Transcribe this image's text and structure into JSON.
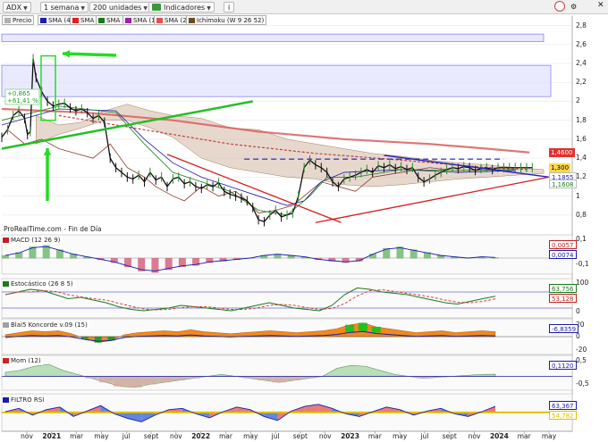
{
  "toolbar": {
    "symbol": "ADX",
    "timeframe": "1 semana",
    "units": "200 unidades",
    "indicators": "Indicadores"
  },
  "legend": [
    {
      "label": "Precio",
      "color": "#b0b0b0"
    },
    {
      "label": "SMA (40)",
      "color": "#1c1caa"
    },
    {
      "label": "SMA (4)",
      "color": "#e02020"
    },
    {
      "label": "SMA (20)",
      "color": "#1a7a1a"
    },
    {
      "label": "SMA (120)",
      "color": "#a020a0"
    },
    {
      "label": "SMA (200)",
      "color": "#e05050"
    },
    {
      "label": "Ichimoku (W 9 26 52)",
      "color": "#6b4b20"
    }
  ],
  "source_note": "ProRealTime.com - Fin de Día",
  "colors": {
    "candle_up": "#2a8a2a",
    "candle_down": "#111111",
    "cloud": "#c9a890",
    "sma200": "#d86060",
    "trendline_green": "#22c022",
    "arrow": "#22dd22",
    "triangle_top": "#2020c0",
    "triangle_bottom": "#d02020",
    "box": "#8888ee"
  },
  "chart_data": [
    {
      "type": "line",
      "name": "price",
      "y_ticks": [
        2.8,
        2.6,
        2.4,
        2.2,
        2,
        1.8,
        1.6,
        1.4,
        1.2,
        1,
        0.8
      ],
      "ylim": [
        0.6,
        2.9
      ],
      "x_ticks": [
        "nov",
        "2021",
        "mar",
        "may",
        "jul",
        "sept",
        "nov",
        "2022",
        "mar",
        "may",
        "jul",
        "sept",
        "nov",
        "2023",
        "mar",
        "may",
        "jul",
        "sept",
        "nov",
        "2024",
        "mar",
        "may"
      ],
      "x_bold": [
        "2021",
        "2022",
        "2023",
        "2024"
      ],
      "series": [
        {
          "x": [
            0,
            2,
            4,
            6,
            8,
            9,
            10,
            11,
            12,
            14,
            16,
            18,
            20,
            22,
            24,
            26,
            28,
            30,
            32,
            34,
            36,
            38,
            40,
            42,
            44,
            46,
            48,
            50,
            52,
            54,
            56,
            58,
            60,
            62,
            64,
            66,
            68,
            70,
            72,
            74,
            76,
            78,
            80,
            82,
            84,
            86,
            88,
            90,
            92,
            94,
            96,
            98,
            100,
            102,
            104,
            106,
            108,
            110,
            112,
            114,
            116,
            118,
            120,
            122,
            124,
            126,
            128,
            130,
            132,
            134,
            136,
            138,
            140,
            142,
            144,
            146,
            148,
            150,
            152,
            154,
            156,
            158,
            160,
            162,
            164,
            166,
            168,
            170,
            172,
            174,
            176,
            178,
            180,
            182,
            184,
            186
          ],
          "values": [
            1.62,
            1.7,
            1.85,
            1.9,
            1.82,
            1.65,
            1.68,
            2.45,
            2.25,
            2.1,
            2.0,
            1.95,
            1.97,
            1.98,
            1.93,
            1.9,
            1.92,
            1.88,
            1.82,
            1.85,
            1.78,
            1.4,
            1.3,
            1.25,
            1.2,
            1.18,
            1.22,
            1.15,
            1.25,
            1.17,
            1.2,
            1.1,
            1.18,
            1.2,
            1.13,
            1.15,
            1.1,
            1.08,
            1.12,
            1.1,
            1.14,
            1.05,
            1.02,
            1.0,
            0.98,
            0.95,
            0.88,
            0.75,
            0.73,
            0.8,
            0.85,
            0.78,
            0.8,
            0.82,
            1.0,
            1.3,
            1.38,
            1.33,
            1.3,
            1.25,
            1.15,
            1.1,
            1.18,
            1.2,
            1.22,
            1.25,
            1.28,
            1.25,
            1.32,
            1.3,
            1.33,
            1.29,
            1.31,
            1.28,
            1.3,
            1.2,
            1.15,
            1.18,
            1.22,
            1.25,
            1.28,
            1.3,
            1.29,
            1.31,
            1.3,
            1.27,
            1.29,
            1.3,
            1.28,
            1.3,
            1.3,
            1.3,
            1.3,
            1.3,
            1.3,
            1.3
          ]
        },
        {
          "name": "SMA (200)",
          "x": [
            0,
            30,
            60,
            90,
            120,
            150,
            170,
            185
          ],
          "values": [
            1.92,
            1.88,
            1.8,
            1.68,
            1.6,
            1.55,
            1.5,
            1.46
          ]
        },
        {
          "name": "SMA (120)",
          "x": [
            20,
            50,
            80,
            110,
            140,
            170,
            185
          ],
          "values": [
            1.85,
            1.7,
            1.55,
            1.45,
            1.38,
            1.3,
            1.28
          ]
        }
      ],
      "current_labels": [
        {
          "value": "1,4600",
          "y": 1.46,
          "color": "#e03030",
          "text_color": "#ffffff"
        },
        {
          "value": "1,300",
          "y": 1.3,
          "color": "#ffd84a",
          "text_color": "#000000"
        },
        {
          "value": "1,1855",
          "y": 1.1855,
          "color": "#ffffff",
          "text_color": "#1c1caa"
        },
        {
          "value": "1,1608",
          "y": 1.1608,
          "color": "#ffffff",
          "text_color": "#1a7a1a"
        }
      ],
      "annotations": [
        "+0,865",
        "+61,41 %"
      ]
    },
    {
      "type": "bar",
      "name": "MACD (12 26 9)",
      "y_ticks": [
        "0,1",
        "-0,1"
      ],
      "labels": [
        {
          "value": "0,0057",
          "color": "#c02020"
        },
        {
          "value": "0,0074",
          "color": "#1c1caa"
        }
      ],
      "values": [
        0.02,
        0.04,
        0.08,
        0.09,
        0.06,
        0.03,
        0.01,
        -0.01,
        -0.03,
        -0.06,
        -0.09,
        -0.1,
        -0.08,
        -0.06,
        -0.05,
        -0.03,
        -0.02,
        -0.01,
        0.0,
        0.02,
        0.03,
        0.02,
        0.01,
        -0.01,
        -0.02,
        -0.03,
        -0.02,
        0.03,
        0.07,
        0.08,
        0.06,
        0.04,
        0.02,
        0.01,
        0.0,
        0.01,
        0.005
      ]
    },
    {
      "type": "line",
      "name": "Estocástico (26 8 5)",
      "y_ticks": [
        "100",
        "0"
      ],
      "labels": [
        {
          "value": "63,756",
          "color": "#1a7a1a"
        },
        {
          "value": "53,128",
          "color": "#c02020"
        }
      ],
      "values": [
        70,
        80,
        90,
        85,
        70,
        55,
        60,
        50,
        40,
        25,
        15,
        10,
        15,
        20,
        30,
        25,
        20,
        15,
        10,
        20,
        30,
        40,
        30,
        20,
        15,
        10,
        30,
        70,
        95,
        90,
        80,
        75,
        70,
        60,
        50,
        40,
        35,
        45,
        55,
        64
      ]
    },
    {
      "type": "area",
      "name": "Blai5 Koncorde v.09 (15)",
      "y_ticks": [
        "20",
        "0",
        "-20"
      ],
      "labels": [
        {
          "value": "-6,8359",
          "color": "#1c1caa"
        }
      ],
      "values": [
        2,
        4,
        6,
        5,
        6,
        3,
        -2,
        -6,
        -4,
        2,
        4,
        5,
        6,
        5,
        7,
        5,
        4,
        3,
        4,
        5,
        6,
        5,
        4,
        5,
        6,
        8,
        12,
        14,
        10,
        8,
        6,
        4,
        5,
        6,
        4,
        5,
        6,
        5
      ]
    },
    {
      "type": "area",
      "name": "Mom (12)",
      "y_ticks": [
        "0,5",
        "-0,5"
      ],
      "labels": [
        {
          "value": "0,1120",
          "color": "#1c1caa"
        }
      ],
      "values": [
        0.2,
        0.3,
        0.5,
        0.6,
        0.3,
        0.1,
        -0.1,
        -0.3,
        -0.5,
        -0.55,
        -0.4,
        -0.3,
        -0.2,
        -0.1,
        0.0,
        0.1,
        0.0,
        -0.1,
        -0.2,
        -0.3,
        -0.2,
        -0.1,
        0.0,
        0.4,
        0.55,
        0.5,
        0.3,
        0.1,
        0.0,
        -0.1,
        -0.05,
        0.0,
        0.05,
        0.1,
        0.11
      ]
    },
    {
      "type": "area",
      "name": "FILTRO RSI",
      "labels": [
        {
          "value": "63,367",
          "color": "#1c1caa"
        },
        {
          "value": "54,782",
          "color": "#e0c000"
        }
      ],
      "values": [
        55,
        60,
        50,
        58,
        62,
        48,
        56,
        64,
        52,
        45,
        40,
        50,
        58,
        60,
        52,
        46,
        55,
        62,
        58,
        48,
        42,
        56,
        63,
        66,
        60,
        52,
        48,
        55,
        62,
        58,
        50,
        56,
        60,
        52,
        48,
        55,
        63
      ]
    }
  ]
}
